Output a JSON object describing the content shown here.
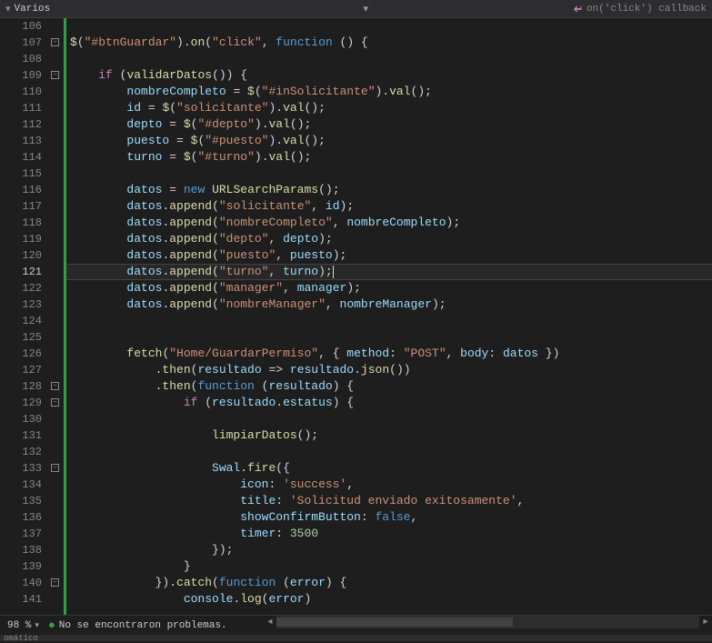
{
  "topbar": {
    "tab_label": "Varios",
    "dropdown_marker": "▾",
    "right_icon": "↩",
    "right_text": "on('click') callback"
  },
  "line_start": 106,
  "line_end": 141,
  "current_line": 121,
  "fold_markers": [
    {
      "line": 107,
      "sym": "−"
    },
    {
      "line": 109,
      "sym": "−"
    },
    {
      "line": 128,
      "sym": "−"
    },
    {
      "line": 129,
      "sym": "−"
    },
    {
      "line": 133,
      "sym": "−"
    },
    {
      "line": 140,
      "sym": "−"
    }
  ],
  "code_lines": [
    {
      "n": 106,
      "t": [
        {
          "c": "tk-p",
          "x": ""
        }
      ]
    },
    {
      "n": 107,
      "t": [
        {
          "c": "tk-i",
          "x": "$"
        },
        {
          "c": "tk-p",
          "x": "("
        },
        {
          "c": "tk-s",
          "x": "\"#btnGuardar\""
        },
        {
          "c": "tk-p",
          "x": ")."
        },
        {
          "c": "tk-i",
          "x": "on"
        },
        {
          "c": "tk-p",
          "x": "("
        },
        {
          "c": "tk-s",
          "x": "\"click\""
        },
        {
          "c": "tk-p",
          "x": ", "
        },
        {
          "c": "tk-k",
          "x": "function"
        },
        {
          "c": "tk-p",
          "x": " () {"
        }
      ]
    },
    {
      "n": 108,
      "t": [
        {
          "c": "tk-p",
          "x": ""
        }
      ]
    },
    {
      "n": 109,
      "t": [
        {
          "c": "tk-p",
          "x": "    "
        },
        {
          "c": "tk-kf",
          "x": "if"
        },
        {
          "c": "tk-p",
          "x": " ("
        },
        {
          "c": "tk-i",
          "x": "validarDatos"
        },
        {
          "c": "tk-p",
          "x": "()) {"
        }
      ]
    },
    {
      "n": 110,
      "t": [
        {
          "c": "tk-p",
          "x": "        "
        },
        {
          "c": "tk-v",
          "x": "nombreCompleto"
        },
        {
          "c": "tk-p",
          "x": " = "
        },
        {
          "c": "tk-i",
          "x": "$"
        },
        {
          "c": "tk-p",
          "x": "("
        },
        {
          "c": "tk-s",
          "x": "\"#inSolicitante\""
        },
        {
          "c": "tk-p",
          "x": ")."
        },
        {
          "c": "tk-i",
          "x": "val"
        },
        {
          "c": "tk-p",
          "x": "();"
        }
      ]
    },
    {
      "n": 111,
      "t": [
        {
          "c": "tk-p",
          "x": "        "
        },
        {
          "c": "tk-v",
          "x": "id"
        },
        {
          "c": "tk-p",
          "x": " = "
        },
        {
          "c": "tk-i",
          "x": "$"
        },
        {
          "c": "tk-p",
          "x": "("
        },
        {
          "c": "tk-s",
          "x": "\"solicitante\""
        },
        {
          "c": "tk-p",
          "x": ")."
        },
        {
          "c": "tk-i",
          "x": "val"
        },
        {
          "c": "tk-p",
          "x": "();"
        }
      ]
    },
    {
      "n": 112,
      "t": [
        {
          "c": "tk-p",
          "x": "        "
        },
        {
          "c": "tk-v",
          "x": "depto"
        },
        {
          "c": "tk-p",
          "x": " = "
        },
        {
          "c": "tk-i",
          "x": "$"
        },
        {
          "c": "tk-p",
          "x": "("
        },
        {
          "c": "tk-s",
          "x": "\"#depto\""
        },
        {
          "c": "tk-p",
          "x": ")."
        },
        {
          "c": "tk-i",
          "x": "val"
        },
        {
          "c": "tk-p",
          "x": "();"
        }
      ]
    },
    {
      "n": 113,
      "t": [
        {
          "c": "tk-p",
          "x": "        "
        },
        {
          "c": "tk-v",
          "x": "puesto"
        },
        {
          "c": "tk-p",
          "x": " = "
        },
        {
          "c": "tk-i",
          "x": "$"
        },
        {
          "c": "tk-p",
          "x": "("
        },
        {
          "c": "tk-s",
          "x": "\"#puesto\""
        },
        {
          "c": "tk-p",
          "x": ")."
        },
        {
          "c": "tk-i",
          "x": "val"
        },
        {
          "c": "tk-p",
          "x": "();"
        }
      ]
    },
    {
      "n": 114,
      "t": [
        {
          "c": "tk-p",
          "x": "        "
        },
        {
          "c": "tk-v",
          "x": "turno"
        },
        {
          "c": "tk-p",
          "x": " = "
        },
        {
          "c": "tk-i",
          "x": "$"
        },
        {
          "c": "tk-p",
          "x": "("
        },
        {
          "c": "tk-s",
          "x": "\"#turno\""
        },
        {
          "c": "tk-p",
          "x": ")."
        },
        {
          "c": "tk-i",
          "x": "val"
        },
        {
          "c": "tk-p",
          "x": "();"
        }
      ]
    },
    {
      "n": 115,
      "t": [
        {
          "c": "tk-p",
          "x": ""
        }
      ]
    },
    {
      "n": 116,
      "t": [
        {
          "c": "tk-p",
          "x": "        "
        },
        {
          "c": "tk-v",
          "x": "datos"
        },
        {
          "c": "tk-p",
          "x": " = "
        },
        {
          "c": "tk-k",
          "x": "new"
        },
        {
          "c": "tk-p",
          "x": " "
        },
        {
          "c": "tk-i",
          "x": "URLSearchParams"
        },
        {
          "c": "tk-p",
          "x": "();"
        }
      ]
    },
    {
      "n": 117,
      "t": [
        {
          "c": "tk-p",
          "x": "        "
        },
        {
          "c": "tk-v",
          "x": "datos"
        },
        {
          "c": "tk-p",
          "x": "."
        },
        {
          "c": "tk-i",
          "x": "append"
        },
        {
          "c": "tk-p",
          "x": "("
        },
        {
          "c": "tk-s",
          "x": "\"solicitante\""
        },
        {
          "c": "tk-p",
          "x": ", "
        },
        {
          "c": "tk-v",
          "x": "id"
        },
        {
          "c": "tk-p",
          "x": ");"
        }
      ]
    },
    {
      "n": 118,
      "t": [
        {
          "c": "tk-p",
          "x": "        "
        },
        {
          "c": "tk-v",
          "x": "datos"
        },
        {
          "c": "tk-p",
          "x": "."
        },
        {
          "c": "tk-i",
          "x": "append"
        },
        {
          "c": "tk-p",
          "x": "("
        },
        {
          "c": "tk-s",
          "x": "\"nombreCompleto\""
        },
        {
          "c": "tk-p",
          "x": ", "
        },
        {
          "c": "tk-v",
          "x": "nombreCompleto"
        },
        {
          "c": "tk-p",
          "x": ");"
        }
      ]
    },
    {
      "n": 119,
      "t": [
        {
          "c": "tk-p",
          "x": "        "
        },
        {
          "c": "tk-v",
          "x": "datos"
        },
        {
          "c": "tk-p",
          "x": "."
        },
        {
          "c": "tk-i",
          "x": "append"
        },
        {
          "c": "tk-p",
          "x": "("
        },
        {
          "c": "tk-s",
          "x": "\"depto\""
        },
        {
          "c": "tk-p",
          "x": ", "
        },
        {
          "c": "tk-v",
          "x": "depto"
        },
        {
          "c": "tk-p",
          "x": ");"
        }
      ]
    },
    {
      "n": 120,
      "t": [
        {
          "c": "tk-p",
          "x": "        "
        },
        {
          "c": "tk-v",
          "x": "datos"
        },
        {
          "c": "tk-p",
          "x": "."
        },
        {
          "c": "tk-i",
          "x": "append"
        },
        {
          "c": "tk-p",
          "x": "("
        },
        {
          "c": "tk-s",
          "x": "\"puesto\""
        },
        {
          "c": "tk-p",
          "x": ", "
        },
        {
          "c": "tk-v",
          "x": "puesto"
        },
        {
          "c": "tk-p",
          "x": ");"
        }
      ]
    },
    {
      "n": 121,
      "t": [
        {
          "c": "tk-p",
          "x": "        "
        },
        {
          "c": "tk-v",
          "x": "datos"
        },
        {
          "c": "tk-p",
          "x": "."
        },
        {
          "c": "tk-i",
          "x": "append"
        },
        {
          "c": "tk-p",
          "x": "("
        },
        {
          "c": "tk-s",
          "x": "\"turno\""
        },
        {
          "c": "tk-p",
          "x": ", "
        },
        {
          "c": "tk-v",
          "x": "turno"
        },
        {
          "c": "tk-p",
          "x": ");"
        }
      ],
      "caret": true
    },
    {
      "n": 122,
      "t": [
        {
          "c": "tk-p",
          "x": "        "
        },
        {
          "c": "tk-v",
          "x": "datos"
        },
        {
          "c": "tk-p",
          "x": "."
        },
        {
          "c": "tk-i",
          "x": "append"
        },
        {
          "c": "tk-p",
          "x": "("
        },
        {
          "c": "tk-s",
          "x": "\"manager\""
        },
        {
          "c": "tk-p",
          "x": ", "
        },
        {
          "c": "tk-v",
          "x": "manager"
        },
        {
          "c": "tk-p",
          "x": ");"
        }
      ]
    },
    {
      "n": 123,
      "t": [
        {
          "c": "tk-p",
          "x": "        "
        },
        {
          "c": "tk-v",
          "x": "datos"
        },
        {
          "c": "tk-p",
          "x": "."
        },
        {
          "c": "tk-i",
          "x": "append"
        },
        {
          "c": "tk-p",
          "x": "("
        },
        {
          "c": "tk-s",
          "x": "\"nombreManager\""
        },
        {
          "c": "tk-p",
          "x": ", "
        },
        {
          "c": "tk-v",
          "x": "nombreManager"
        },
        {
          "c": "tk-p",
          "x": ");"
        }
      ]
    },
    {
      "n": 124,
      "t": [
        {
          "c": "tk-p",
          "x": ""
        }
      ]
    },
    {
      "n": 125,
      "t": [
        {
          "c": "tk-p",
          "x": ""
        }
      ]
    },
    {
      "n": 126,
      "t": [
        {
          "c": "tk-p",
          "x": "        "
        },
        {
          "c": "tk-i",
          "x": "fetch"
        },
        {
          "c": "tk-p",
          "x": "("
        },
        {
          "c": "tk-s",
          "x": "\"Home/GuardarPermiso\""
        },
        {
          "c": "tk-p",
          "x": ", { "
        },
        {
          "c": "tk-v",
          "x": "method"
        },
        {
          "c": "tk-p",
          "x": ": "
        },
        {
          "c": "tk-s",
          "x": "\"POST\""
        },
        {
          "c": "tk-p",
          "x": ", "
        },
        {
          "c": "tk-v",
          "x": "body"
        },
        {
          "c": "tk-p",
          "x": ": "
        },
        {
          "c": "tk-v",
          "x": "datos"
        },
        {
          "c": "tk-p",
          "x": " })"
        }
      ]
    },
    {
      "n": 127,
      "t": [
        {
          "c": "tk-p",
          "x": "            ."
        },
        {
          "c": "tk-i",
          "x": "then"
        },
        {
          "c": "tk-p",
          "x": "("
        },
        {
          "c": "tk-v",
          "x": "resultado"
        },
        {
          "c": "tk-p",
          "x": " => "
        },
        {
          "c": "tk-v",
          "x": "resultado"
        },
        {
          "c": "tk-p",
          "x": "."
        },
        {
          "c": "tk-i",
          "x": "json"
        },
        {
          "c": "tk-p",
          "x": "())"
        }
      ]
    },
    {
      "n": 128,
      "t": [
        {
          "c": "tk-p",
          "x": "            ."
        },
        {
          "c": "tk-i",
          "x": "then"
        },
        {
          "c": "tk-p",
          "x": "("
        },
        {
          "c": "tk-k",
          "x": "function"
        },
        {
          "c": "tk-p",
          "x": " ("
        },
        {
          "c": "tk-v",
          "x": "resultado"
        },
        {
          "c": "tk-p",
          "x": ") {"
        }
      ]
    },
    {
      "n": 129,
      "t": [
        {
          "c": "tk-p",
          "x": "                "
        },
        {
          "c": "tk-kf",
          "x": "if"
        },
        {
          "c": "tk-p",
          "x": " ("
        },
        {
          "c": "tk-v",
          "x": "resultado"
        },
        {
          "c": "tk-p",
          "x": "."
        },
        {
          "c": "tk-v",
          "x": "estatus"
        },
        {
          "c": "tk-p",
          "x": ") {"
        }
      ]
    },
    {
      "n": 130,
      "t": [
        {
          "c": "tk-p",
          "x": ""
        }
      ]
    },
    {
      "n": 131,
      "t": [
        {
          "c": "tk-p",
          "x": "                    "
        },
        {
          "c": "tk-i",
          "x": "limpiarDatos"
        },
        {
          "c": "tk-p",
          "x": "();"
        }
      ]
    },
    {
      "n": 132,
      "t": [
        {
          "c": "tk-p",
          "x": ""
        }
      ]
    },
    {
      "n": 133,
      "t": [
        {
          "c": "tk-p",
          "x": "                    "
        },
        {
          "c": "tk-v",
          "x": "Swal"
        },
        {
          "c": "tk-p",
          "x": "."
        },
        {
          "c": "tk-i",
          "x": "fire"
        },
        {
          "c": "tk-p",
          "x": "({"
        }
      ]
    },
    {
      "n": 134,
      "t": [
        {
          "c": "tk-p",
          "x": "                        "
        },
        {
          "c": "tk-v",
          "x": "icon"
        },
        {
          "c": "tk-p",
          "x": ": "
        },
        {
          "c": "tk-s",
          "x": "'success'"
        },
        {
          "c": "tk-p",
          "x": ","
        }
      ]
    },
    {
      "n": 135,
      "t": [
        {
          "c": "tk-p",
          "x": "                        "
        },
        {
          "c": "tk-v",
          "x": "title"
        },
        {
          "c": "tk-p",
          "x": ": "
        },
        {
          "c": "tk-s",
          "x": "'Solicitud enviado exitosamente'"
        },
        {
          "c": "tk-p",
          "x": ","
        }
      ]
    },
    {
      "n": 136,
      "t": [
        {
          "c": "tk-p",
          "x": "                        "
        },
        {
          "c": "tk-v",
          "x": "showConfirmButton"
        },
        {
          "c": "tk-p",
          "x": ": "
        },
        {
          "c": "tk-b",
          "x": "false"
        },
        {
          "c": "tk-p",
          "x": ","
        }
      ]
    },
    {
      "n": 137,
      "t": [
        {
          "c": "tk-p",
          "x": "                        "
        },
        {
          "c": "tk-v",
          "x": "timer"
        },
        {
          "c": "tk-p",
          "x": ": "
        },
        {
          "c": "tk-n",
          "x": "3500"
        }
      ]
    },
    {
      "n": 138,
      "t": [
        {
          "c": "tk-p",
          "x": "                    });"
        }
      ]
    },
    {
      "n": 139,
      "t": [
        {
          "c": "tk-p",
          "x": "                }"
        }
      ]
    },
    {
      "n": 140,
      "t": [
        {
          "c": "tk-p",
          "x": "            })."
        },
        {
          "c": "tk-i",
          "x": "catch"
        },
        {
          "c": "tk-p",
          "x": "("
        },
        {
          "c": "tk-k",
          "x": "function"
        },
        {
          "c": "tk-p",
          "x": " ("
        },
        {
          "c": "tk-v",
          "x": "error"
        },
        {
          "c": "tk-p",
          "x": ") {"
        }
      ]
    },
    {
      "n": 141,
      "t": [
        {
          "c": "tk-p",
          "x": "                "
        },
        {
          "c": "tk-v",
          "x": "console"
        },
        {
          "c": "tk-p",
          "x": "."
        },
        {
          "c": "tk-i",
          "x": "log"
        },
        {
          "c": "tk-p",
          "x": "("
        },
        {
          "c": "tk-v",
          "x": "error"
        },
        {
          "c": "tk-p",
          "x": ")"
        }
      ]
    }
  ],
  "status": {
    "zoom": "98 %",
    "no_issues": "No se encontraron problemas."
  },
  "bottom_strip": "omático"
}
